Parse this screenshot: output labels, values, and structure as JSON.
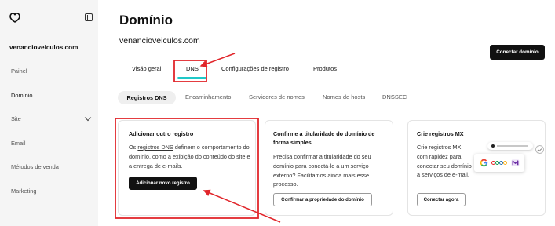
{
  "colors": {
    "accent": "#1fc8c8",
    "primary_button": "#111111",
    "annotation": "#e1262b",
    "sidebar_bg": "#f5f5f5"
  },
  "sidebar": {
    "logo_icon": "brand-logo-icon",
    "collapse_icon": "sidebar-collapse-icon",
    "account_name": "venancioveiculos.com",
    "items": [
      {
        "label": "Painel",
        "active": false
      },
      {
        "label": "Domínio",
        "active": true
      },
      {
        "label": "Site",
        "active": false,
        "trailing_icon": "chevron-down-icon"
      },
      {
        "label": "Email",
        "active": false
      },
      {
        "label": "Métodos de venda",
        "active": false
      },
      {
        "label": "Marketing",
        "active": false
      }
    ]
  },
  "header": {
    "title": "Domínio",
    "domain_name": "venancioveiculos.com",
    "connect_button_label": "Conectar domínio"
  },
  "tabs": [
    {
      "label": "Visão geral",
      "active": false
    },
    {
      "label": "DNS",
      "active": true
    },
    {
      "label": "Configurações de registro",
      "active": false
    },
    {
      "label": "Produtos",
      "active": false
    }
  ],
  "subtabs": [
    {
      "label": "Registros DNS",
      "active": true
    },
    {
      "label": "Encaminhamento",
      "active": false
    },
    {
      "label": "Servidores de nomes",
      "active": false
    },
    {
      "label": "Nomes de hosts",
      "active": false
    },
    {
      "label": "DNSSEC",
      "active": false
    }
  ],
  "cards": [
    {
      "title": "Adicionar outro registro",
      "body_before_link": "Os ",
      "body_link": "registros DNS",
      "body_after_link": " definem o comportamento do domínio, como a exibição do conteúdo do site e a entrega de e-mails.",
      "button_label": "Adicionar novo registro"
    },
    {
      "title": "Confirme a titularidade do domínio de forma simples",
      "body": "Precisa confirmar a titularidade do seu domínio para conectá-lo a um serviço externo? Facilitamos ainda mais esse processo.",
      "button_label": "Confirmar a propriedade do domínio"
    },
    {
      "title": "Crie registros MX",
      "body": "Crie registros MX com rapidez para conectar seu domínio a serviços de e-mail.",
      "button_label": "Conectar agora",
      "illustration_icons": [
        "google-icon",
        "zoho-icon",
        "purple-mail-icon",
        "check-circle-icon"
      ]
    }
  ]
}
